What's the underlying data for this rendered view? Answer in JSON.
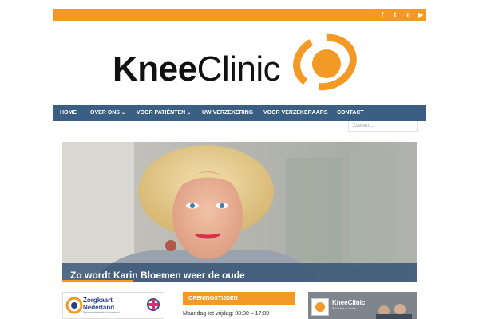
{
  "social": {
    "icons": [
      {
        "name": "facebook-icon",
        "glyph": "f"
      },
      {
        "name": "twitter-icon",
        "glyph": "t"
      },
      {
        "name": "linkedin-icon",
        "glyph": "in"
      },
      {
        "name": "youtube-icon",
        "glyph": "▶"
      }
    ]
  },
  "brand": {
    "knee": "Knee",
    "clinic": "Clinic",
    "accent_color": "#f39a26",
    "nav_color": "#3b5f83"
  },
  "nav": {
    "items": [
      {
        "label": "HOME",
        "has_dropdown": false
      },
      {
        "label": "OVER ONS",
        "has_dropdown": true
      },
      {
        "label": "VOOR PATIËNTEN",
        "has_dropdown": true
      },
      {
        "label": "UW VERZEKERING",
        "has_dropdown": false
      },
      {
        "label": "VOOR VERZEKERAARS",
        "has_dropdown": false
      },
      {
        "label": "CONTACT",
        "has_dropdown": false
      }
    ]
  },
  "search": {
    "placeholder": "Zoeken ..."
  },
  "hero": {
    "caption": "Zo wordt Karin Bloemen weer de oude"
  },
  "sidebar": {
    "zorgkaart_title": "Zorgkaart",
    "zorgkaart_subtitle": "Nederland",
    "zorgkaart_tagline": "Patiëntenfederatie Nederland",
    "openingstijden_heading": "OPENINGSTIJDEN",
    "hours_line": "Maandag tot vrijdag: 08:30 – 17:00",
    "fb_page_name": "KneeClinic",
    "fb_page_sub": "502 vind-ik-leuks"
  }
}
